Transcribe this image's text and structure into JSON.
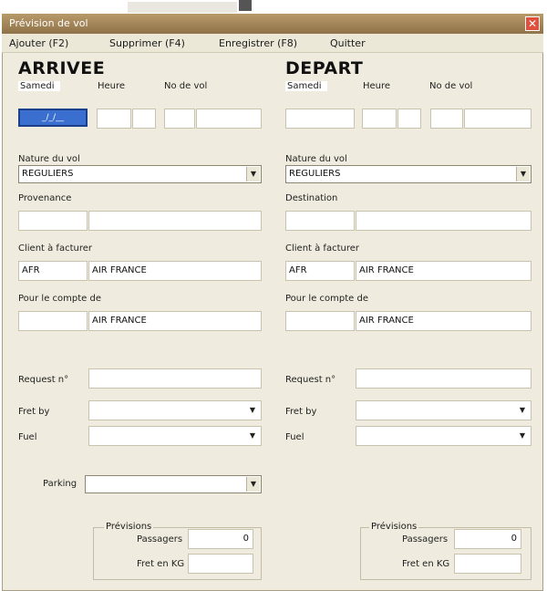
{
  "window": {
    "title": "Prévision de vol",
    "close_glyph": "✕"
  },
  "menu": {
    "items": [
      "Ajouter (F2)",
      "Supprimer (F4)",
      "Enregistrer (F8)",
      "Quitter"
    ]
  },
  "arrivee": {
    "title": "ARRIVEE",
    "day_label": "Samedi",
    "time_label": "Heure",
    "flight_label": "No de vol",
    "date_value": "_/_/__",
    "nature_label": "Nature du vol",
    "nature_value": "REGULIERS",
    "place_label": "Provenance",
    "client_label": "Client à facturer",
    "client_code": "AFR",
    "client_name": "AIR FRANCE",
    "account_label": "Pour le compte de",
    "account_code": "",
    "account_name": "AIR FRANCE",
    "request_label": "Request n°",
    "fret_label": "Fret by",
    "fuel_label": "Fuel",
    "parking_label": "Parking",
    "prev_label": "Prévisions",
    "passengers_label": "Passagers",
    "passengers_value": "0",
    "fret_kg_label": "Fret en KG",
    "fret_kg_value": ""
  },
  "depart": {
    "title": "DEPART",
    "day_label": "Samedi",
    "time_label": "Heure",
    "flight_label": "No de vol",
    "nature_label": "Nature du vol",
    "nature_value": "REGULIERS",
    "place_label": "Destination",
    "client_label": "Client à facturer",
    "client_code": "AFR",
    "client_name": "AIR FRANCE",
    "account_label": "Pour le compte de",
    "account_code": "",
    "account_name": "AIR FRANCE",
    "request_label": "Request n°",
    "fret_label": "Fret by",
    "fuel_label": "Fuel",
    "prev_label": "Prévisions",
    "passengers_label": "Passagers",
    "passengers_value": "0",
    "fret_kg_label": "Fret en KG",
    "fret_kg_value": ""
  },
  "icons": {
    "dropdown": "▼",
    "close": "close-icon"
  }
}
